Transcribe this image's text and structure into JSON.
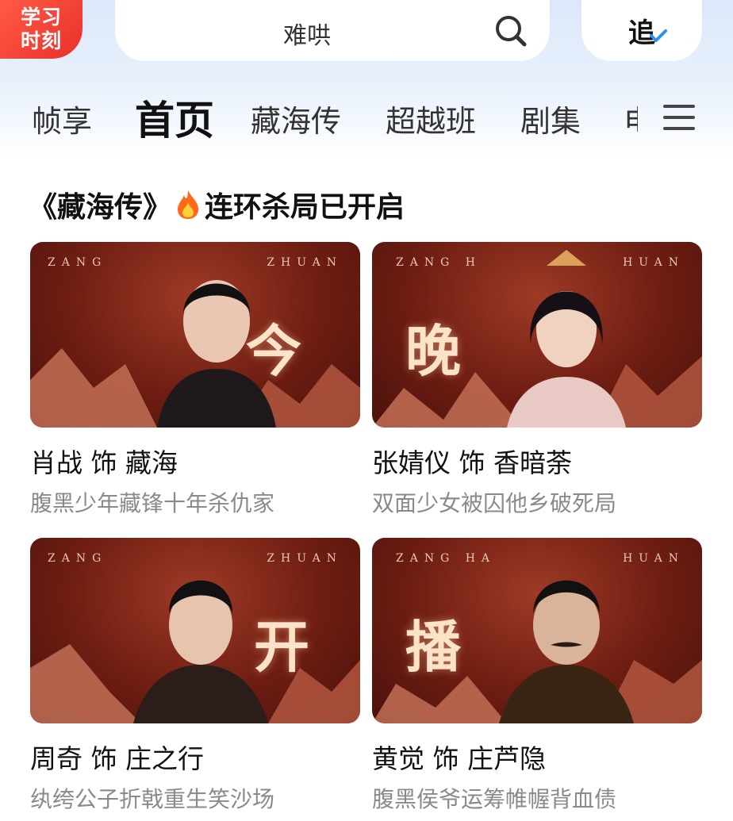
{
  "header": {
    "badge_line1": "学习",
    "badge_line2": "时刻",
    "search_text": "难哄",
    "follow_label": "追"
  },
  "tabs": [
    {
      "label": "帧享"
    },
    {
      "label": "首页",
      "active": true
    },
    {
      "label": "藏海传"
    },
    {
      "label": "超越班"
    },
    {
      "label": "剧集"
    },
    {
      "label": "电"
    }
  ],
  "section": {
    "title_prefix": "《藏海传》",
    "title_suffix": "连环杀局已开启"
  },
  "cards": [
    {
      "poster_brand_left": "ZANG",
      "poster_brand_right": "ZHUAN",
      "poster_char": "今",
      "title": "肖战 饰 藏海",
      "desc": "腹黑少年藏锋十年杀仇家"
    },
    {
      "poster_brand_left": "ZANG H",
      "poster_brand_right": "HUAN",
      "poster_char": "晚",
      "title": "张婧仪 饰 香暗荼",
      "desc": "双面少女被囚他乡破死局"
    },
    {
      "poster_brand_left": "ZANG",
      "poster_brand_right": "ZHUAN",
      "poster_char": "开",
      "title": "周奇 饰 庄之行",
      "desc": "纨绔公子折戟重生笑沙场"
    },
    {
      "poster_brand_left": "ZANG HA",
      "poster_brand_right": "HUAN",
      "poster_char": "播",
      "title": "黄觉 饰 庄芦隐",
      "desc": "腹黑侯爷运筹帷幄背血债"
    }
  ],
  "colors": {
    "badge_red": "#e9302c",
    "accent_blue": "#2f8ff0",
    "poster_red": "#6e1d12",
    "desc_gray": "#8a8a8a"
  }
}
